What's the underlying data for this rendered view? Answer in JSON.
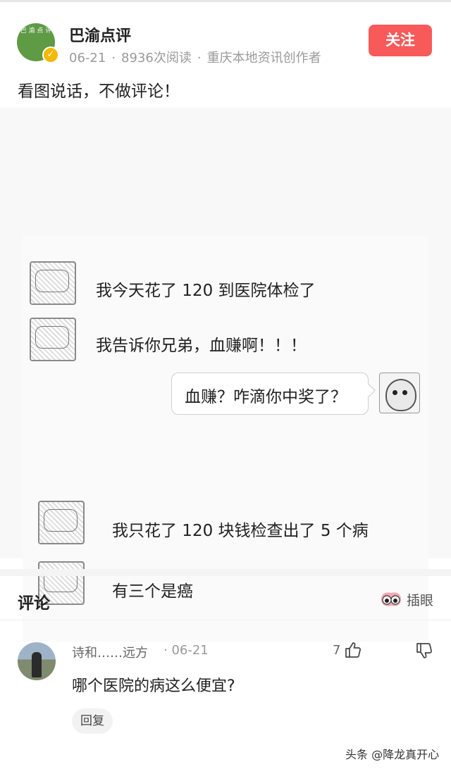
{
  "post": {
    "author": "巴渝点评",
    "avatar_text": "巴 渝 点 评",
    "date": "06-21",
    "reads": "8936次阅读",
    "role": "重庆本地资讯创作者",
    "follow_label": "关注",
    "caption": "看图说话，不做评论！"
  },
  "image": {
    "messages": [
      {
        "side": "left",
        "text": "我今天花了 120 到医院体检了"
      },
      {
        "side": "left",
        "text": "我告诉你兄弟，血赚啊！！！"
      },
      {
        "side": "right",
        "text": "血赚？咋滴你中奖了？"
      },
      {
        "side": "left",
        "text": "我只花了 120 块钱检查出了 5 个病"
      },
      {
        "side": "left",
        "text": "有三个是癌"
      }
    ]
  },
  "comments": {
    "title": "评论",
    "eyes_label": "插眼",
    "items": [
      {
        "user": "诗和……远方",
        "date": "· 06-21",
        "likes": "7",
        "text": "哪个医院的病这么便宜?",
        "reply_label": "回复"
      }
    ]
  },
  "watermark": "头条 @降龙真开心",
  "colors": {
    "follow": "#f85959",
    "verified": "#f5b800",
    "avatar": "#5f9a45"
  },
  "icons": [
    "verified-badge-icon",
    "eyes-icon",
    "thumbs-up-icon",
    "thumbs-down-icon"
  ]
}
